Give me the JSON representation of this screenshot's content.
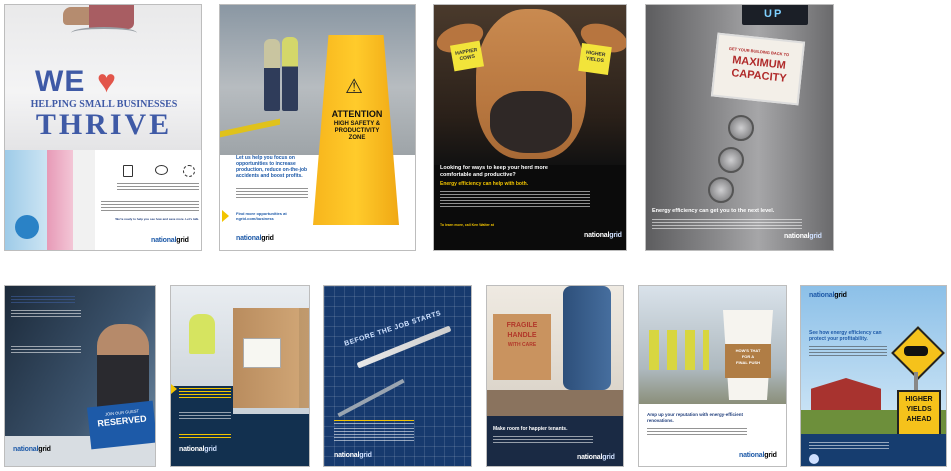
{
  "ads": {
    "a1": {
      "we": "WE",
      "helping": "HELPING SMALL BUSINESSES",
      "thrive": "THRIVE",
      "contact": "We're ready to help you see how and save more. Let's talk.",
      "logo_a": "national",
      "logo_b": "grid"
    },
    "a2": {
      "sign1": "ATTENTION",
      "sign2": "HIGH SAFETY &",
      "sign3": "PRODUCTIVITY",
      "sign4": "ZONE",
      "headline": "Let us help you focus on opportunities to increase production, reduce on-the-job accidents and boost profits.",
      "cta": "Find more opportunities at ngrid.com/business",
      "logo_a": "national",
      "logo_b": "grid"
    },
    "a3": {
      "tag_left": "HAPPIER COWS",
      "tag_right": "HIGHER YIELDS",
      "headline": "Looking for ways to keep your herd more comfortable and productive?",
      "subhead": "Energy efficiency can help with both.",
      "cta": "To learn more, call Ken Walter at",
      "logo_a": "national",
      "logo_b": "grid"
    },
    "a4": {
      "display": "UP",
      "sign_small": "GET YOUR BUILDING BACK TO",
      "sign1": "MAXIMUM",
      "sign2": "CAPACITY",
      "headline": "Energy efficiency can get you to the next level.",
      "logo_a": "national",
      "logo_b": "grid"
    },
    "b1": {
      "sign1": "JOIN OUR GUEST",
      "sign2": "RESERVED",
      "logo_a": "national",
      "logo_b": "grid"
    },
    "b2": {
      "logo_a": "national",
      "logo_b": "grid"
    },
    "b3": {
      "banner": "BEFORE THE JOB STARTS",
      "logo_a": "national",
      "logo_b": "grid"
    },
    "b4": {
      "box1": "FRAGILE",
      "box2": "HANDLE",
      "box3": "WITH CARE",
      "headline": "Make room for happier tenants.",
      "logo_a": "national",
      "logo_b": "grid"
    },
    "b5": {
      "cup1": "HOW'S THAT",
      "cup2": "FOR A",
      "cup3": "FINAL PUSH",
      "headline": "Amp up your reputation with energy-efficient renovations.",
      "logo_a": "national",
      "logo_b": "grid"
    },
    "b6": {
      "logo_a": "national",
      "logo_b": "grid",
      "headline": "See how energy efficiency can protect your profitability.",
      "sign1": "HIGHER",
      "sign2": "YIELDS",
      "sign3": "AHEAD"
    }
  }
}
